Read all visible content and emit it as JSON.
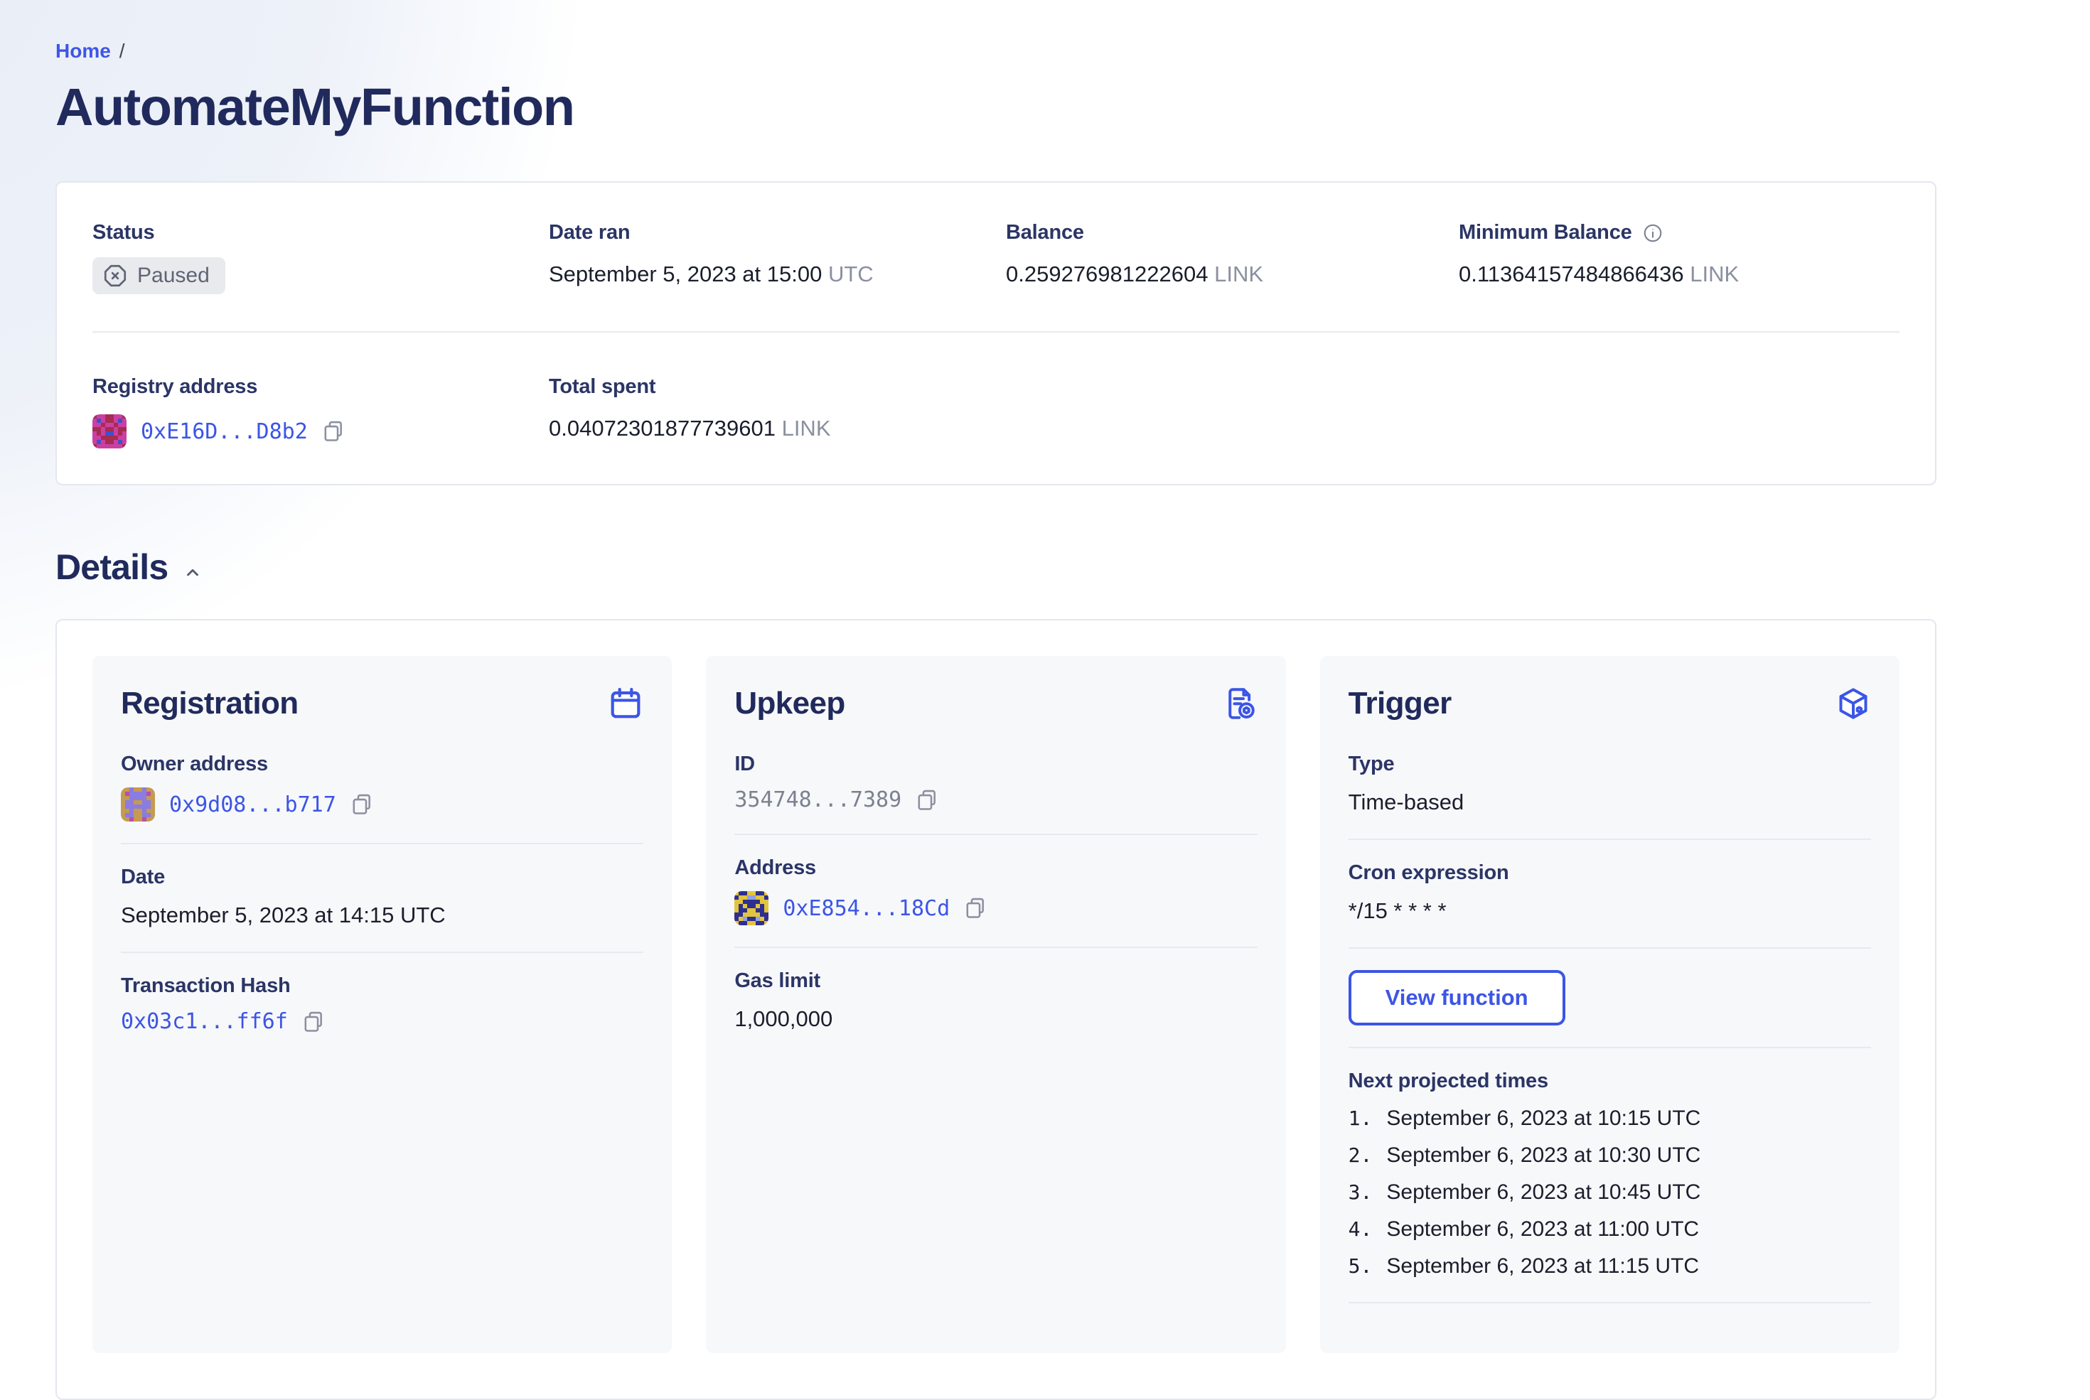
{
  "breadcrumb": {
    "home": "Home",
    "separator": "/"
  },
  "page_title": "AutomateMyFunction",
  "colors": {
    "accent_blue": "#3c55e6",
    "heading_navy": "#202a5c",
    "label_navy": "#2b3566",
    "text_dark": "#1a1e2c",
    "muted_gray": "#8a909f",
    "badge_bg": "#e9eaee",
    "badge_text": "#5e6473",
    "card_border": "#e5e7ee",
    "subcard_bg": "#f7f8fa"
  },
  "summary": {
    "status": {
      "label": "Status",
      "badge": "Paused",
      "icon": "octagon-x-icon"
    },
    "date_ran": {
      "label": "Date ran",
      "value": "September 5, 2023 at 15:00",
      "suffix": "UTC"
    },
    "balance": {
      "label": "Balance",
      "value": "0.259276981222604",
      "unit": "LINK"
    },
    "min_balance": {
      "label": "Minimum Balance",
      "value": "0.11364157484866436",
      "unit": "LINK",
      "icon": "info-icon"
    },
    "registry": {
      "label": "Registry address",
      "address": "0xE16D...D8b2"
    },
    "total_spent": {
      "label": "Total spent",
      "value": "0.04072301877739601",
      "unit": "LINK"
    }
  },
  "details": {
    "heading": "Details",
    "registration": {
      "title": "Registration",
      "icon": "calendar-icon",
      "owner_label": "Owner address",
      "owner_address": "0x9d08...b717",
      "date_label": "Date",
      "date_value": "September 5, 2023 at 14:15 UTC",
      "tx_label": "Transaction Hash",
      "tx_hash": "0x03c1...ff6f"
    },
    "upkeep": {
      "title": "Upkeep",
      "icon": "document-gear-icon",
      "id_label": "ID",
      "id_value": "354748...7389",
      "address_label": "Address",
      "address": "0xE854...18Cd",
      "gas_label": "Gas limit",
      "gas_value": "1,000,000"
    },
    "trigger": {
      "title": "Trigger",
      "icon": "cube-icon",
      "type_label": "Type",
      "type_value": "Time-based",
      "cron_label": "Cron expression",
      "cron_value": "*/15 * * * *",
      "button": "View function",
      "next_label": "Next projected times",
      "times": [
        "September 6, 2023 at 10:15 UTC",
        "September 6, 2023 at 10:30 UTC",
        "September 6, 2023 at 10:45 UTC",
        "September 6, 2023 at 11:00 UTC",
        "September 6, 2023 at 11:15 UTC"
      ]
    }
  },
  "avatars": {
    "registry": {
      "palette": {
        "p": "#cb3fa3",
        "c": "#a62c52",
        "b": "#4150c8"
      },
      "rows": [
        "cppccppc",
        "pbpccpbp",
        "ppcppcpp",
        "ccpccpcc",
        "pcpbbpcp",
        "ppccccpp",
        "pbpccpbp",
        "cppppppc"
      ]
    },
    "owner": {
      "palette": {
        "t": "#c59a52",
        "u": "#8a7ce0",
        "m": "#b84fae"
      },
      "rows": [
        "ttuttutt",
        "tmuuuumt",
        "ttuuuutt",
        "tuuttuut",
        "tuuuuuut",
        "ttuttutt",
        "tuuttuut",
        "ttmttmtt"
      ]
    },
    "upkeep": {
      "palette": {
        "n": "#2e2f8f",
        "y": "#e3c43c",
        "l": "#8fa2e8"
      },
      "rows": [
        "ynnyynny",
        "nyyllyyn",
        "yynnnnyy",
        "ynynnyny",
        "ynnyynny",
        "nnyyyynn",
        "nylnnlyn",
        "ynnyynny"
      ]
    }
  }
}
